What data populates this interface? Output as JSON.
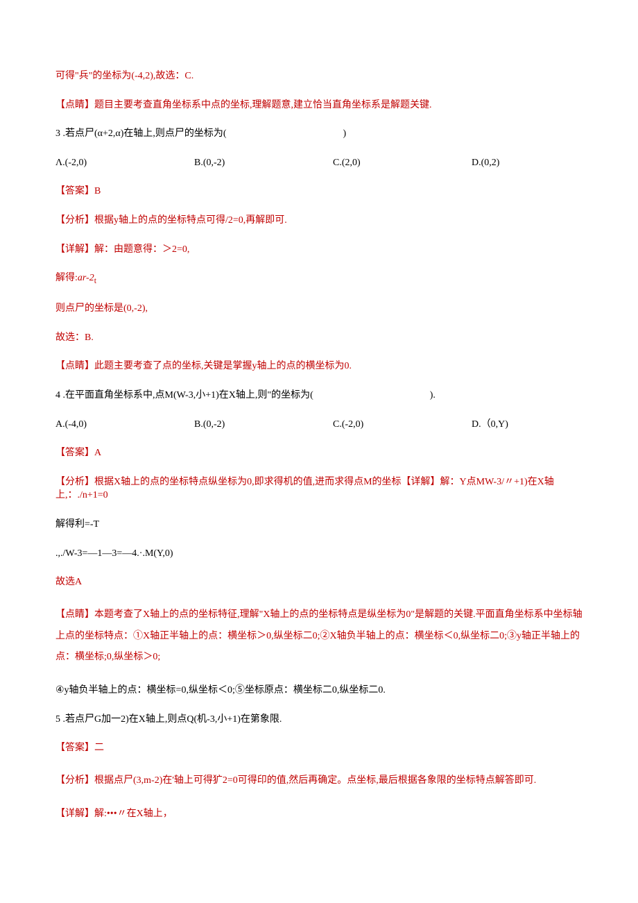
{
  "l01": "可得\"兵\"的坐标为(-4,2),故选：C.",
  "l02": "【点睛】题目主要考查直角坐标系中点的坐标,理解题意,建立恰当直角坐标系是解题关键.",
  "q3_stem": "3 .若点尸(α+2,α)在轴上,则点尸的坐标为(　　　　　　　　　　　　)",
  "q3_A": "Λ.(-2,0)",
  "q3_B": "B.(0,-2)",
  "q3_C": "C.(2,0)",
  "q3_D": "D.(0,2)",
  "q3_ans": "【答案】B",
  "q3_fx": "【分析】根据y轴上的点的坐标特点可得/2=0,再解即可.",
  "q3_xj": "【详解】解：由题意得：＞2=0,",
  "q3_solve1": "解得:",
  "q3_solve1_i": "ar-2",
  "q3_solve1_t": "t",
  "q3_solve2": "则点尸的坐标是(0,-2),",
  "q3_gx": "故选：B.",
  "q3_dj": "【点睛】此题主要考查了点的坐标,关键是掌握y轴上的点的横坐标为0.",
  "q4_stem": "4 .在平面直角坐标系中,点M(W-3,小+1)在X轴上,则\"的坐标为(　　　　　　　　　　　　).",
  "q4_A": "A.(-4,0)",
  "q4_B": "B.(0,-2)",
  "q4_C": "C.(-2,0)",
  "q4_D": "D.（0,Y)",
  "q4_ans": "【答案】A",
  "q4_fx": "【分析】根据X轴上的点的坐标特点纵坐标为0,即求得机的值,进而求得点M的坐标【详解】解：Y点MW-3/〃+1)在X轴上,：./n+1=0",
  "q4_s1": "解得利=-T",
  "q4_s2": ".,./W-3=—1—3=—4.·.M(Y,0)",
  "q4_gx": "故选A",
  "q4_dj1": "【点睛】本题考查了X轴上的点的坐标特征,理解\"X轴上的点的坐标特点是纵坐标为0\"是解题的关键.平面直角坐标系中坐标轴上点的坐标特点：①X轴正半轴上的点：横坐标＞0,纵坐标二0;②X轴负半轴上的点：横坐标＜0,纵坐标二0;③y轴正半轴上的点：横坐标;0,纵坐标＞0;",
  "q4_dj2": "④y轴负半轴上的点：横坐标=0,纵坐标＜0;⑤坐标原点：横坐标二0,纵坐标二0.",
  "q5_stem": "5 .若点尸G加一2)在X轴上,则点Q(机-3,小+1)在第象限.",
  "q5_ans": "【答案】二",
  "q5_fx": "【分析】根据点尸(3,m-2)在'轴上可得犷2=0可得印的值,然后再确定。点坐标,最后根据各象限的坐标特点解答即可.",
  "q5_xj": "【详解】解:•••〃在X轴上，"
}
